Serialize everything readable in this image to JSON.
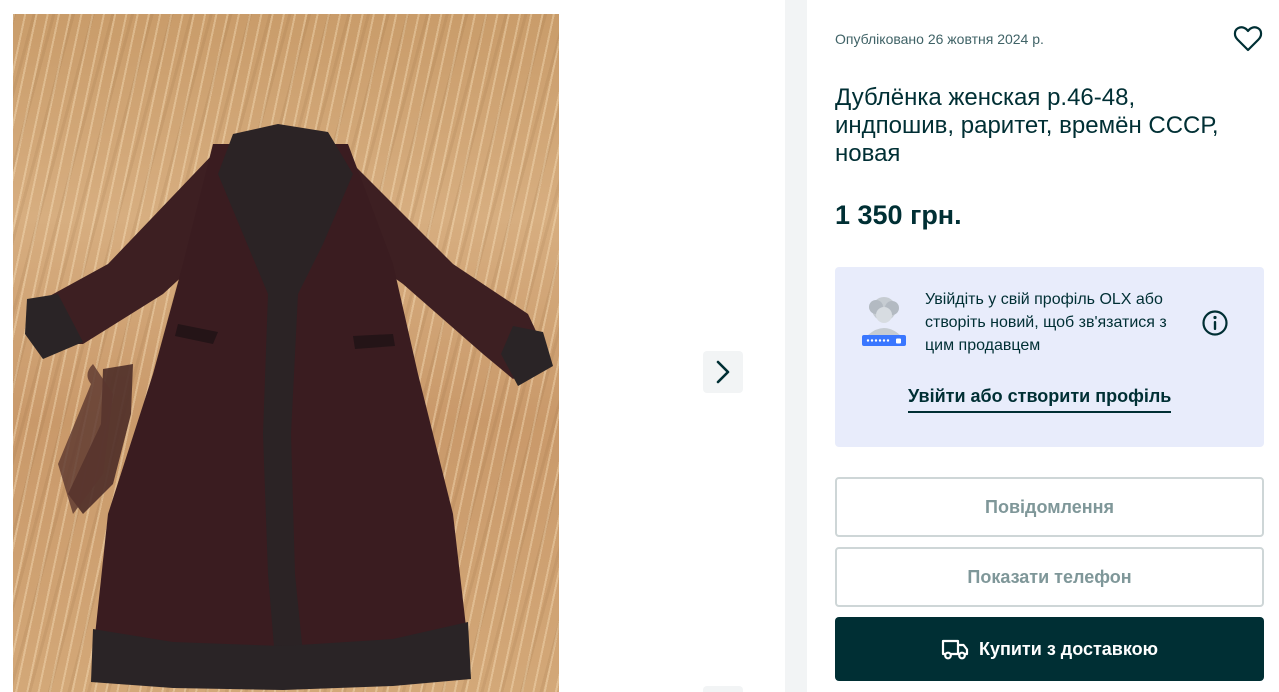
{
  "gallery": {
    "photo_alt": "Дублёнка женская",
    "next_icon": "chevron-right-icon"
  },
  "listing": {
    "published": "Опубліковано 26 жовтня 2024 р.",
    "title": "Дублёнка женская р.46-48, индпошив, раритет, времён СССР, новая",
    "price": "1 350 грн.",
    "favorite_icon": "heart-icon"
  },
  "login_prompt": {
    "text": "Увійдіть у свій профіль OLX або створіть новий, щоб зв'язатися з цим продавцем",
    "link": "Увійти або створити профіль",
    "info_icon": "info-icon"
  },
  "actions": {
    "message": "Повідомлення",
    "show_phone": "Показати телефон",
    "buy_with_delivery": "Купити з доставкою",
    "buy_icon": "truck-icon"
  },
  "colors": {
    "text": "#002f34",
    "muted": "#406367",
    "login_bg": "#e8ecfb",
    "primary_button": "#002f34",
    "button_border": "#ced6d7",
    "disabled_text": "#7f9799"
  }
}
